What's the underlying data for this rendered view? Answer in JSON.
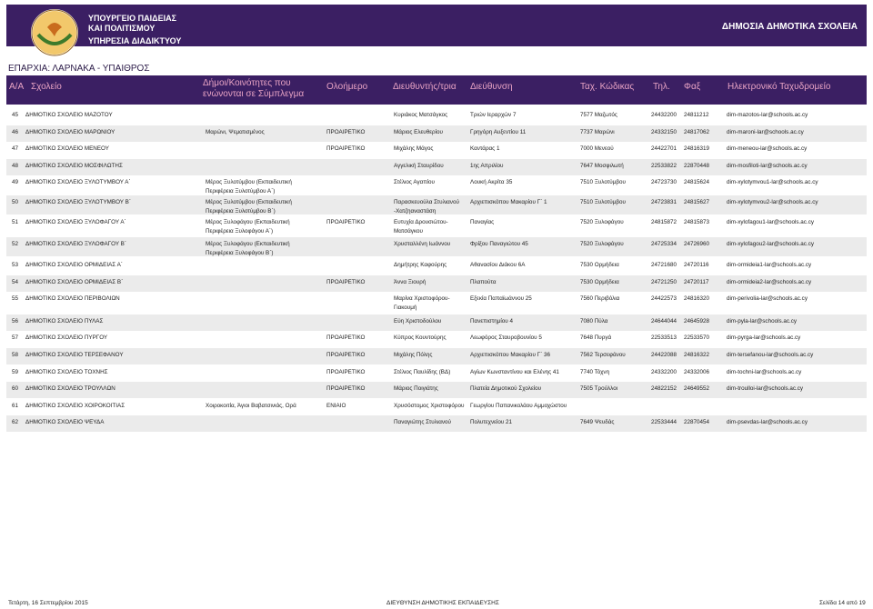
{
  "banner": {
    "ministry_line1": "ΥΠΟΥΡΓΕΙΟ ΠΑΙΔΕΙΑΣ",
    "ministry_line2": "ΚΑΙ ΠΟΛΙΤΙΣΜΟΥ",
    "service": "ΥΠΗΡΕΣΙΑ ΔΙΑΔΙΚΤΥΟΥ",
    "report_title": "ΔΗΜΟΣΙΑ ΔΗΜΟΤΙΚΑ ΣΧΟΛΕΙΑ"
  },
  "province": "ΕΠΑΡΧΙΑ:  ΛΑΡΝΑΚΑ - ΥΠΑΙΘΡΟΣ",
  "columns": {
    "no": "Α/Α",
    "school": "Σχολείο",
    "communities_1": "Δήμοι/Κοινότητες που",
    "communities_2": "ενώνονται σε Σύμπλεγμα",
    "allday": "Ολοήμερο",
    "director": "Διευθυντής/τρια",
    "address": "Διεύθυνση",
    "postcode": "Ταχ. Κώδικας",
    "tel": "Τηλ.",
    "fax": "Φαξ",
    "email": "Ηλεκτρονικό Ταχυδρομείο"
  },
  "rows": [
    {
      "no": "45",
      "name": "ΔΗΜΟΤΙΚΟ ΣΧΟΛΕΙΟ ΜΑΖΟΤΟΥ",
      "comm": "",
      "kind": "",
      "dir": "Κυριάκος Ματσάγκος",
      "addr": "Τριών Ιεραρχών 7",
      "post": "7577 Μαζωτός",
      "tel": "24432200",
      "fax": "24811212",
      "mail": "dim-mazotos-lar@schools.ac.cy"
    },
    {
      "no": "46",
      "name": "ΔΗΜΟΤΙΚΟ ΣΧΟΛΕΙΟ ΜΑΡΩΝΙΟΥ",
      "comm": "Μαρώνι, Ψεματισμένος",
      "kind": "ΠΡΟΑΙΡΕΤΙΚΟ",
      "dir": "Μάριος Ελευθερίου",
      "addr": "Γρηγόρη Αυξεντίου 11",
      "post": "7737 Μαρώνι",
      "tel": "24332150",
      "fax": "24817062",
      "mail": "dim-maroni-lar@schools.ac.cy"
    },
    {
      "no": "47",
      "name": "ΔΗΜΟΤΙΚΟ ΣΧΟΛΕΙΟ ΜΕΝΕΟΥ",
      "comm": "",
      "kind": "ΠΡΟΑΙΡΕΤΙΚΟ",
      "dir": "Μιχάλης Μάγος",
      "addr": "Καντάρας 1",
      "post": "7000 Μενεού",
      "tel": "24422701",
      "fax": "24816319",
      "mail": "dim-meneou-lar@schools.ac.cy"
    },
    {
      "no": "48",
      "name": "ΔΗΜΟΤΙΚΟ ΣΧΟΛΕΙΟ ΜΟΣΦΙΛΩΤΗΣ",
      "comm": "",
      "kind": "",
      "dir": "Αγγελική Σταυρίδου",
      "addr": "1ης Απριλίου",
      "post": "7647 Μοσφιλωτή",
      "tel": "22533822",
      "fax": "22870448",
      "mail": "dim-mosfiloti-lar@schools.ac.cy"
    },
    {
      "no": "49",
      "name": "ΔΗΜΟΤΙΚΟ ΣΧΟΛΕΙΟ ΞΥΛΟΤΥΜΒΟΥ Α΄",
      "comm": "Μέρος Ξυλοτύμβου (Εκπαιδευτική",
      "comm2": "Περιφέρεια Ξυλοτύμβου Α΄)",
      "kind": "",
      "dir": "Στέλιος Αγαπίου",
      "addr": "Λουκή Ακρίτα 35",
      "post": "7510 Ξυλοτύμβου",
      "tel": "24723730",
      "fax": "24815624",
      "mail": "dim-xylotymvou1-lar@schools.ac.cy"
    },
    {
      "no": "50",
      "name": "ΔΗΜΟΤΙΚΟ ΣΧΟΛΕΙΟ ΞΥΛΟΤΥΜΒΟΥ Β΄",
      "comm": "Μέρος Ξυλοτύμβου (Εκπαιδευτική",
      "comm2": "Περιφέρεια Ξυλοτύμβου Β΄)",
      "kind": "",
      "dir": "Παρασκευούλα Στυλιανού",
      "dir2": "-Χατζηαναστάση",
      "addr": "Αρχιεπισκόπου Μακαρίου Γ΄ 1",
      "post": "7510 Ξυλοτύμβου",
      "tel": "24723831",
      "fax": "24815627",
      "mail": "dim-xylotymvou2-lar@schools.ac.cy"
    },
    {
      "no": "51",
      "name": "ΔΗΜΟΤΙΚΟ ΣΧΟΛΕΙΟ ΞΥΛΟΦΑΓΟΥ Α΄",
      "comm": "Μέρος Ξυλοφάγου (Εκπαιδευτική",
      "comm2": "Περιφέρεια Ξυλοφάγου Α΄)",
      "kind": "ΠΡΟΑΙΡΕΤΙΚΟ",
      "dir": "Ευτυχία Δρουσιώτου-",
      "dir2": "Ματσάγκου",
      "addr": "Παναγίας",
      "post": "7520 Ξυλοφάγου",
      "tel": "24815872",
      "fax": "24815873",
      "mail": "dim-xylofagou1-lar@schools.ac.cy"
    },
    {
      "no": "52",
      "name": "ΔΗΜΟΤΙΚΟ ΣΧΟΛΕΙΟ ΞΥΛΟΦΑΓΟΥ Β΄",
      "comm": "Μέρος Ξυλοφάγου (Εκπαιδευτική",
      "comm2": "Περιφέρεια Ξυλοφάγου Β΄)",
      "kind": "",
      "dir": "Χρυσταλλένη Ιωάννου",
      "addr": "Φρίξου Παναγιώτου 45",
      "post": "7520 Ξυλοφάγου",
      "tel": "24725334",
      "fax": "24726960",
      "mail": "dim-xylofagou2-lar@schools.ac.cy"
    },
    {
      "no": "53",
      "name": "ΔΗΜΟΤΙΚΟ ΣΧΟΛΕΙΟ ΟΡΜΙΔΕΙΑΣ Α΄",
      "comm": "",
      "kind": "",
      "dir": "Δημήτρης Καφούρης",
      "addr": "Αθανασίου Διάκου 6Α",
      "post": "7530 Ορμήδεια",
      "tel": "24721680",
      "fax": "24720116",
      "mail": "dim-ormideia1-lar@schools.ac.cy"
    },
    {
      "no": "54",
      "name": "ΔΗΜΟΤΙΚΟ ΣΧΟΛΕΙΟ ΟΡΜΙΔΕΙΑΣ Β΄",
      "comm": "",
      "kind": "ΠΡΟΑΙΡΕΤΙΚΟ",
      "dir": "Άννα Ξιουρή",
      "addr": "Πλαπούτα",
      "post": "7530 Ορμήδεια",
      "tel": "24721250",
      "fax": "24720117",
      "mail": "dim-ormideia2-lar@schools.ac.cy"
    },
    {
      "no": "55",
      "name": "ΔΗΜΟΤΙΚΟ ΣΧΟΛΕΙΟ ΠΕΡΙΒΟΛΙΩΝ",
      "comm": "",
      "kind": "",
      "dir": "Μαρίνα Χριστοφόρου-",
      "dir2": "Γιακουμή",
      "addr": "Εξεκία Παπαϊωάννου 25",
      "post": "7560 Περιβόλια",
      "tel": "24422573",
      "fax": "24816320",
      "mail": "dim-perivolia-lar@schools.ac.cy"
    },
    {
      "no": "56",
      "name": "ΔΗΜΟΤΙΚΟ ΣΧΟΛΕΙΟ ΠΥΛΑΣ",
      "comm": "",
      "kind": "",
      "dir": "Εύη Χριστοδούλου",
      "addr": "Πανεπιστημίου 4",
      "post": "7080 Πύλα",
      "tel": "24644044",
      "fax": "24645928",
      "mail": "dim-pyla-lar@schools.ac.cy"
    },
    {
      "no": "57",
      "name": "ΔΗΜΟΤΙΚΟ ΣΧΟΛΕΙΟ ΠΥΡΓΟΥ",
      "comm": "",
      "kind": "ΠΡΟΑΙΡΕΤΙΚΟ",
      "dir": "Κύπρος Κουντούρης",
      "addr": "Λεωφόρος Σταυροβουνίου 5",
      "post": "7648 Πυργά",
      "tel": "22533513",
      "fax": "22533570",
      "mail": "dim-pyrga-lar@schools.ac.cy"
    },
    {
      "no": "58",
      "name": "ΔΗΜΟΤΙΚΟ ΣΧΟΛΕΙΟ ΤΕΡΣΕΦΑΝΟΥ",
      "comm": "",
      "kind": "ΠΡΟΑΙΡΕΤΙΚΟ",
      "dir": "Μιχάλης Πόλης",
      "addr": "Αρχιεπισκόπου Μακαρίου Γ΄ 36",
      "post": "7562 Τερσεφάνου",
      "tel": "24422088",
      "fax": "24816322",
      "mail": "dim-tersefanou-lar@schools.ac.cy"
    },
    {
      "no": "59",
      "name": "ΔΗΜΟΤΙΚΟ ΣΧΟΛΕΙΟ ΤΟΧΝΗΣ",
      "comm": "",
      "kind": "ΠΡΟΑΙΡΕΤΙΚΟ",
      "dir": "Στέλιος Παυλίδης (ΒΔ)",
      "addr": "Αγίων Κωνσταντίνου και Ελένης 41",
      "post": "7740 Τόχνη",
      "tel": "24332200",
      "fax": "24332006",
      "mail": "dim-tochni-lar@schools.ac.cy"
    },
    {
      "no": "60",
      "name": "ΔΗΜΟΤΙΚΟ ΣΧΟΛΕΙΟ ΤΡΟΥΛΛΩΝ",
      "comm": "",
      "kind": "ΠΡΟΑΙΡΕΤΙΚΟ",
      "dir": "Μάριος Ποιγιάτης",
      "addr": "Πλατεία Δημοτικού Σχολείου",
      "post": "7505 Τρούλλοι",
      "tel": "24822152",
      "fax": "24649552",
      "mail": "dim-troulloi-lar@schools.ac.cy"
    },
    {
      "no": "61",
      "name": "ΔΗΜΟΤΙΚΟ ΣΧΟΛΕΙΟ ΧΟΙΡΟΚΟΙΤΙΑΣ",
      "comm": "Χοιροκοιτία, Άγιοι Βαβατσινιάς, Ορά",
      "kind": "ΕΝΙΑΙΟ",
      "dir": "Χρυσόστομος Χριστοφόρου",
      "addr": "Γεωργίου Παπανικολάου Αμμοχώστου",
      "post": "",
      "tel": "",
      "fax": "",
      "mail": ""
    },
    {
      "no": "62",
      "name": "ΔΗΜΟΤΙΚΟ ΣΧΟΛΕΙΟ ΨΕΥΔΑ",
      "comm": "",
      "kind": "",
      "dir": "Παναγιώτης Στυλιανού",
      "addr": "Πολυτεχνείου 21",
      "post": "7649 Ψευδάς",
      "tel": "22533444",
      "fax": "22870454",
      "mail": "dim-psevdas-lar@schools.ac.cy"
    }
  ],
  "footer": {
    "date": "Τετάρτη, 16 Σεπτεμβρίου 2015",
    "center": "ΔΙΕΥΘΥΝΣΗ ΔΗΜΟΤΙΚΗΣ ΕΚΠΑΙΔΕΥΣΗΣ",
    "page": "Σελίδα 14 από 19"
  },
  "colors": {
    "banner": "#3b1f63",
    "header_text": "#e8a3c4",
    "row_alt": "#ebebeb"
  }
}
